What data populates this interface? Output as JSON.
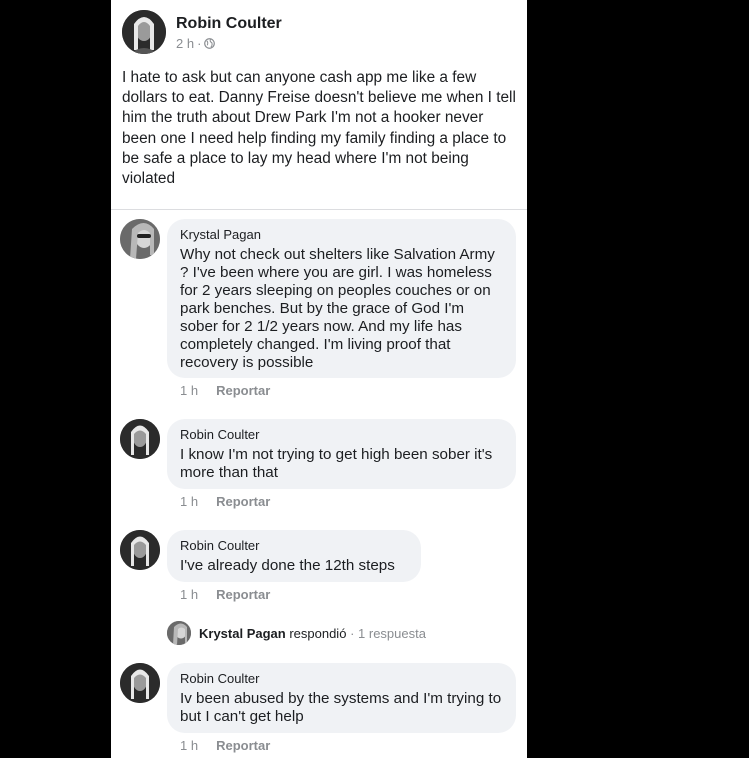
{
  "post": {
    "author": "Robin Coulter",
    "time": "2 h",
    "separator": "·",
    "privacy_icon": "globe-icon",
    "text": "I hate to ask but can anyone cash app me like a few dollars to eat. Danny Freise doesn't believe me when I tell him the truth about Drew Park I'm not a hooker never been one I need help finding my family finding a place to be safe a place to lay my head where I'm not being violated"
  },
  "comments": [
    {
      "author": "Krystal Pagan",
      "text": "Why not check out shelters like Salvation Army ? I've been where you are girl. I was homeless for 2 years sleeping on peoples couches or on park benches. But by the grace of God I'm sober for 2 1/2 years now. And my life has completely changed. I'm living proof that recovery is possible",
      "time": "1 h",
      "report_label": "Reportar"
    },
    {
      "author": "Robin Coulter",
      "text": "I know I'm not trying to get high been sober it's more than that",
      "time": "1 h",
      "report_label": "Reportar"
    },
    {
      "author": "Robin Coulter",
      "text": "I've already done the 12th steps",
      "time": "1 h",
      "report_label": "Reportar",
      "replies": {
        "name": "Krystal Pagan",
        "verb": "respondió",
        "separator": "·",
        "count": "1 respuesta"
      }
    },
    {
      "author": "Robin Coulter",
      "text": "Iv been abused by the systems and I'm trying to but I can't get help",
      "time": "1 h",
      "report_label": "Reportar"
    }
  ],
  "colors": {
    "background": "#000000",
    "panel": "#ffffff",
    "bubble": "#f0f2f5",
    "muted_text": "#8a8d91"
  }
}
